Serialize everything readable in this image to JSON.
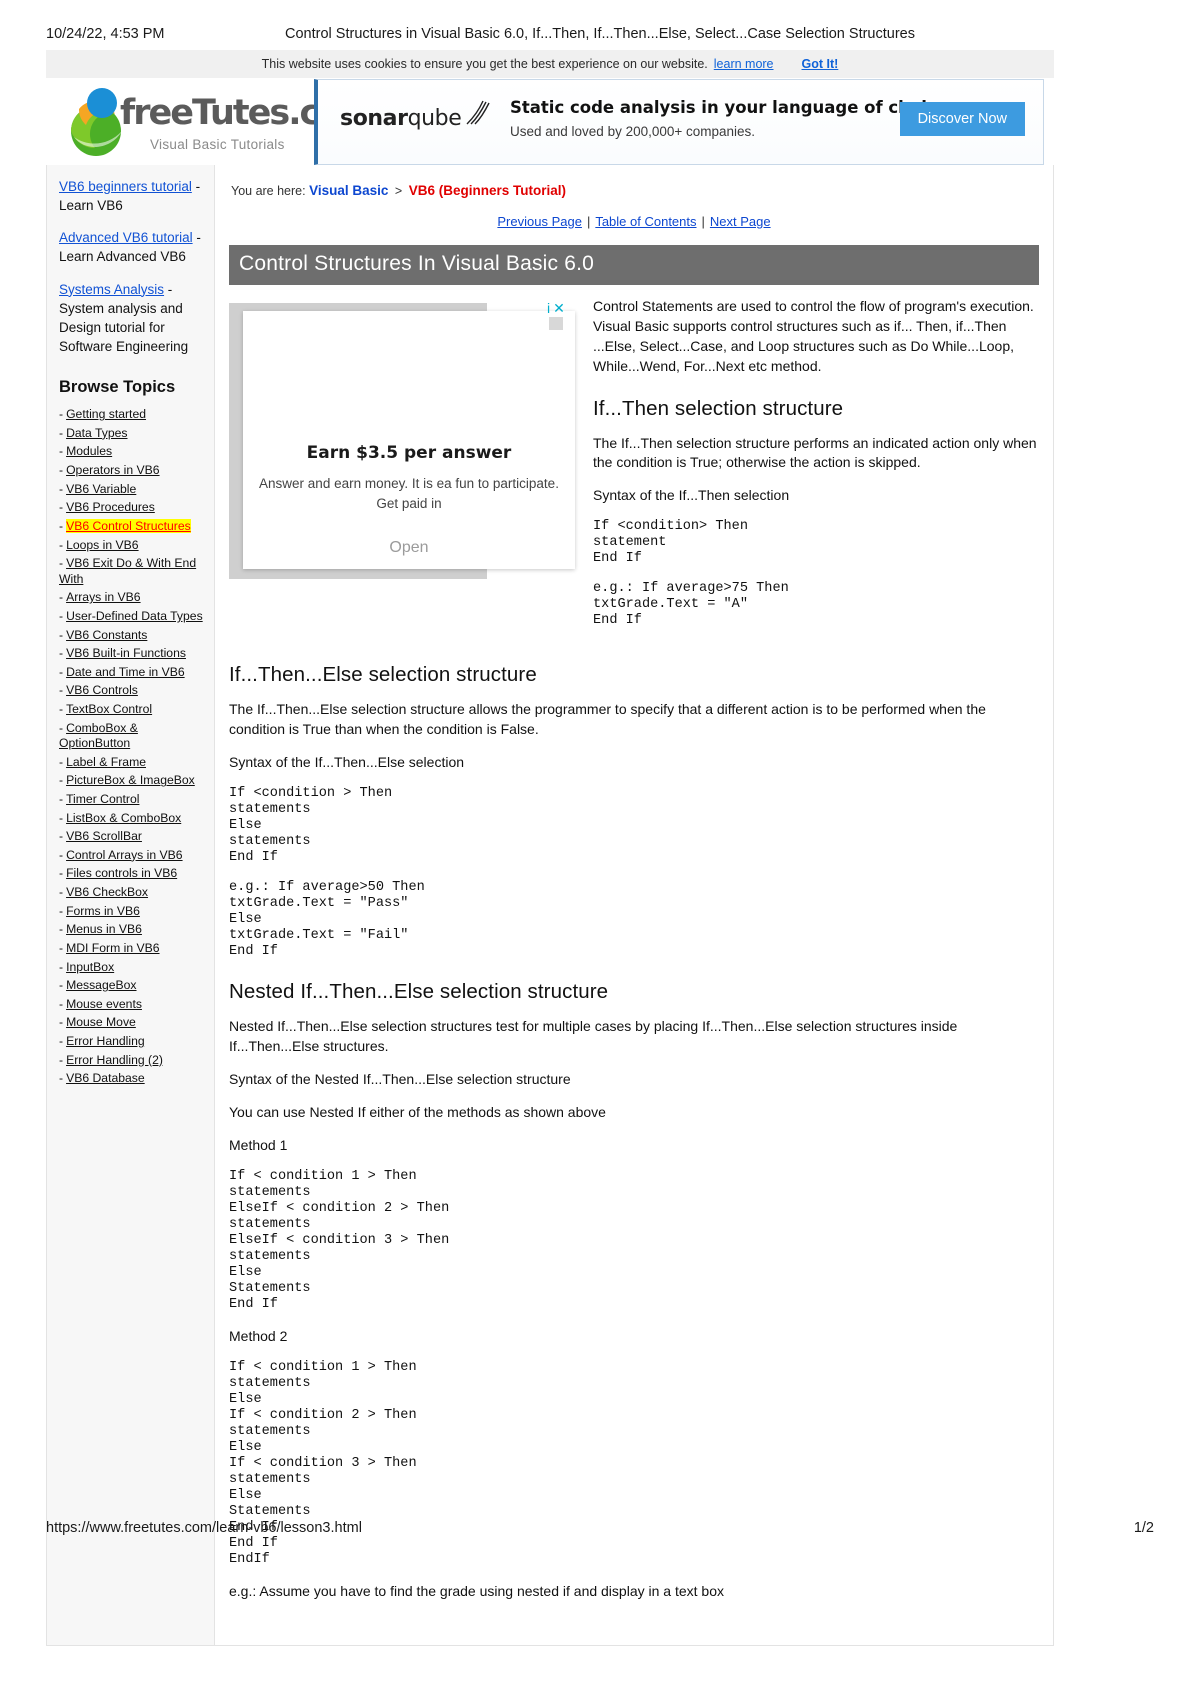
{
  "print": {
    "date": "10/24/22, 4:53 PM",
    "title": "Control Structures in Visual Basic 6.0, If...Then, If...Then...Else, Select...Case Selection Structures",
    "url": "https://www.freetutes.com/learn-vb6/lesson3.html",
    "page_number": "1/2"
  },
  "cookie_bar": {
    "message": "This website uses cookies to ensure you get the best experience on our website.",
    "learn_more": "learn more",
    "got_it": "Got It!"
  },
  "masthead": {
    "logo_text": "freeTutes.com",
    "logo_tagline": "Visual Basic Tutorials",
    "banner_ad": {
      "brand_bold": "sonar",
      "brand_light": "qube",
      "headline": "Static code analysis in your language of choice.",
      "subline": "Used and loved by 200,000+ companies.",
      "cta": "Discover Now"
    }
  },
  "sidebar": {
    "links": [
      {
        "link": "VB6 beginners tutorial",
        "dash": " - ",
        "desc": "Learn VB6"
      },
      {
        "link": "Advanced VB6 tutorial",
        "dash": " - ",
        "desc": "Learn Advanced VB6"
      },
      {
        "link": "Systems Analysis",
        "dash": " - ",
        "desc": "System analysis and Design tutorial for Software Engineering"
      }
    ],
    "browse_title": "Browse Topics",
    "topics": [
      {
        "label": "Getting started",
        "active": false
      },
      {
        "label": "Data Types",
        "active": false
      },
      {
        "label": "Modules",
        "active": false
      },
      {
        "label": "Operators in VB6",
        "active": false
      },
      {
        "label": "VB6 Variable",
        "active": false
      },
      {
        "label": "VB6 Procedures",
        "active": false
      },
      {
        "label": "VB6 Control Structures",
        "active": true
      },
      {
        "label": "Loops in VB6",
        "active": false
      },
      {
        "label": "VB6 Exit Do & With End With",
        "active": false
      },
      {
        "label": "Arrays in VB6",
        "active": false
      },
      {
        "label": "User-Defined Data Types",
        "active": false
      },
      {
        "label": "VB6 Constants",
        "active": false
      },
      {
        "label": "VB6 Built-in Functions",
        "active": false
      },
      {
        "label": "Date and Time in VB6",
        "active": false
      },
      {
        "label": "VB6 Controls",
        "active": false
      },
      {
        "label": "TextBox Control",
        "active": false
      },
      {
        "label": "ComboBox & OptionButton",
        "active": false
      },
      {
        "label": "Label & Frame",
        "active": false
      },
      {
        "label": "PictureBox & ImageBox",
        "active": false
      },
      {
        "label": "Timer Control",
        "active": false
      },
      {
        "label": "ListBox & ComboBox",
        "active": false
      },
      {
        "label": "VB6 ScrollBar",
        "active": false
      },
      {
        "label": "Control Arrays in VB6",
        "active": false
      },
      {
        "label": "Files controls in VB6",
        "active": false
      },
      {
        "label": "VB6 CheckBox",
        "active": false
      },
      {
        "label": "Forms in VB6",
        "active": false
      },
      {
        "label": "Menus in VB6",
        "active": false
      },
      {
        "label": "MDI Form in VB6",
        "active": false
      },
      {
        "label": "InputBox",
        "active": false
      },
      {
        "label": "MessageBox",
        "active": false
      },
      {
        "label": "Mouse events",
        "active": false
      },
      {
        "label": "Mouse Move",
        "active": false
      },
      {
        "label": "Error Handling",
        "active": false
      },
      {
        "label": "Error Handling (2)",
        "active": false
      },
      {
        "label": "VB6 Database",
        "active": false
      }
    ]
  },
  "breadcrumb": {
    "label": "You are here:",
    "root": "Visual Basic",
    "separator": ">",
    "current": "VB6 (Beginners Tutorial)"
  },
  "pager": {
    "previous": "Previous Page",
    "toc": "Table of Contents",
    "next": "Next Page",
    "sep": "|"
  },
  "page_title": "Control Structures In Visual Basic 6.0",
  "inline_ad": {
    "headline": "Earn $3.5 per answer",
    "body": "Answer and earn money. It is ea fun to participate. Get paid in",
    "open": "Open",
    "info_icon": "i",
    "close_icon": "✕"
  },
  "content": {
    "intro": "Control Statements are used to control the flow of program's execution. Visual Basic supports control structures such as if... Then, if...Then ...Else, Select...Case, and Loop structures such as Do While...Loop, While...Wend, For...Next etc method.",
    "sections": [
      {
        "heading": "If...Then selection structure",
        "paragraphs": [
          "The If...Then selection structure performs an indicated action only when the condition is True; otherwise the action is skipped.",
          "Syntax of the  If...Then  selection"
        ],
        "code_blocks": [
          "If <condition> Then\nstatement\nEnd If",
          "e.g.: If average>75 Then\ntxtGrade.Text = \"A\"\nEnd If"
        ]
      },
      {
        "heading": "If...Then...Else selection structure",
        "paragraphs": [
          "The If...Then...Else selection structure allows the programmer to specify that a different action is to be performed when the condition is True than when the condition is False.",
          "Syntax of the  If...Then...Else selection"
        ],
        "code_blocks": [
          "If <condition > Then\nstatements\nElse\nstatements\nEnd If",
          "e.g.: If average>50 Then\ntxtGrade.Text = \"Pass\"\nElse\ntxtGrade.Text = \"Fail\"\nEnd If"
        ]
      },
      {
        "heading": "Nested If...Then...Else selection structure",
        "paragraphs": [
          "Nested If...Then...Else selection structures test for multiple cases by placing If...Then...Else selection structures inside If...Then...Else structures.",
          "Syntax of the Nested If...Then...Else selection structure",
          "You can use Nested If either of the methods as shown above",
          "Method 1"
        ],
        "code_blocks": [
          "If < condition 1 > Then\nstatements\nElseIf < condition 2 > Then\nstatements\nElseIf < condition 3 > Then\nstatements\nElse\nStatements\nEnd If"
        ],
        "paragraphs2": [
          "Method 2"
        ],
        "code_blocks2": [
          "If < condition 1 > Then\nstatements\nElse\nIf < condition 2 > Then\nstatements\nElse\nIf < condition 3 > Then\nstatements\nElse\nStatements\nEnd If\nEnd If\nEndIf"
        ],
        "closing": "e.g.: Assume you have to find the grade using nested if and display in a text box"
      }
    ]
  }
}
